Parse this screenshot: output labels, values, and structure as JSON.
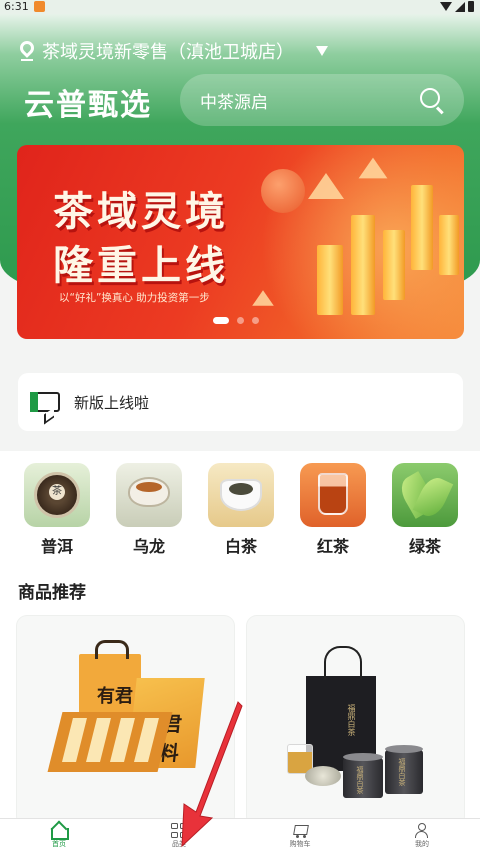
{
  "status_bar": {
    "time": "6:31"
  },
  "header": {
    "location": "茶域灵境新零售（滇池卫城店）",
    "brand": "云普甄选",
    "search_text": "中茶源启"
  },
  "banner": {
    "title_line1": "茶域灵境",
    "title_line2": "隆重上线",
    "subtitle": "以“好礼”换真心 助力投资第一步",
    "slide_count": 3,
    "active_slide": 1
  },
  "notice": {
    "text": "新版上线啦"
  },
  "categories": [
    {
      "label": "普洱",
      "icon": "pu-erh-cake-icon",
      "cake_glyph": "茶"
    },
    {
      "label": "乌龙",
      "icon": "oolong-cup-icon"
    },
    {
      "label": "白茶",
      "icon": "white-tea-bowl-icon"
    },
    {
      "label": "红茶",
      "icon": "black-tea-glass-icon"
    },
    {
      "label": "绿茶",
      "icon": "green-tea-leaf-icon"
    }
  ],
  "recommend": {
    "title": "商品推荐",
    "products": [
      {
        "image": "gift-tea-box-set",
        "brand_text": "有君有料"
      },
      {
        "image": "black-bag-tea-cans",
        "bag_text": "福鼎白茶",
        "can_text": "福鼎白茶"
      }
    ]
  },
  "tabbar": {
    "tabs": [
      {
        "label": "首页",
        "icon": "home-icon",
        "active": true
      },
      {
        "label": "品类",
        "icon": "grid-icon",
        "active": false
      },
      {
        "label": "购物车",
        "icon": "cart-icon",
        "active": false
      },
      {
        "label": "我的",
        "icon": "user-icon",
        "active": false
      }
    ]
  },
  "colors": {
    "brand_green": "#2e9a4e",
    "banner_red": "#e0241b",
    "pointer_red": "#e8323a"
  }
}
